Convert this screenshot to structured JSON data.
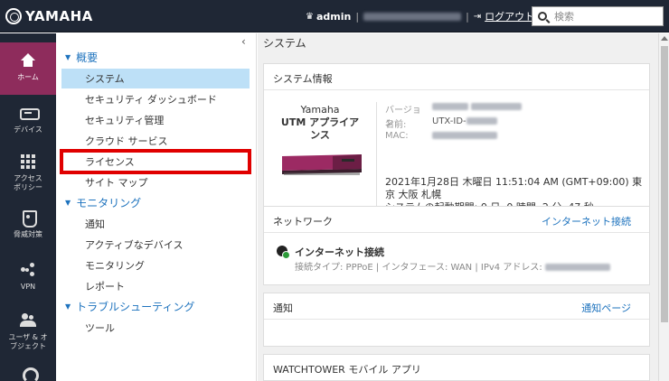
{
  "header": {
    "brand": "YAMAHA",
    "user": "admin",
    "separator": "|",
    "logout_label": "ログアウト",
    "search_placeholder": "検索"
  },
  "rail": {
    "items": [
      {
        "label": "ホーム",
        "icon": "home-icon"
      },
      {
        "label": "デバイス",
        "icon": "device-icon"
      },
      {
        "label": "アクセス ポリシー",
        "icon": "grid-icon"
      },
      {
        "label": "脅威対策",
        "icon": "shield-icon"
      },
      {
        "label": "VPN",
        "icon": "network-icon"
      },
      {
        "label": "ユーザ & オブジェクト",
        "icon": "users-icon"
      }
    ]
  },
  "nav": {
    "groups": [
      {
        "label": "概要",
        "items": [
          "システム",
          "セキュリティ ダッシュボード",
          "セキュリティ管理",
          "クラウド サービス",
          "ライセンス",
          "サイト マップ"
        ]
      },
      {
        "label": "モニタリング",
        "items": [
          "通知",
          "アクティブなデバイス",
          "モニタリング",
          "レポート"
        ]
      },
      {
        "label": "トラブルシューティング",
        "items": [
          "ツール"
        ]
      }
    ]
  },
  "main": {
    "title": "システム",
    "system_card": {
      "heading": "システム情報",
      "product_brand": "Yamaha",
      "product_name": "UTM アプライアンス",
      "version_label": "バージョン:",
      "name_label": "名前:",
      "name_value": "UTX-ID-",
      "mac_label": "MAC:",
      "datetime": "2021年1月28日 木曜日 11:51:04 AM (GMT+09:00) 東京 大阪 札幌",
      "uptime": "システムの起動期間: 0 日, 0 時間, 2 分, 47 秒"
    },
    "network_card": {
      "heading": "ネットワーク",
      "link": "インターネット接続",
      "status": "インターネット接続",
      "detail": "接続タイプ: PPPoE | インタフェース: WAN | IPv4 アドレス:"
    },
    "notify_card": {
      "heading": "通知",
      "link": "通知ページ"
    },
    "app_card": {
      "heading": "WATCHTOWER モバイル アプリ"
    }
  }
}
